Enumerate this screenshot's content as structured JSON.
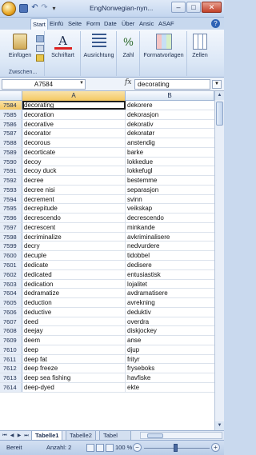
{
  "window": {
    "title": "EngNorwegian-nyn...",
    "minimize": "‒",
    "maximize": "□",
    "close": "✕"
  },
  "ribbon_tabs": [
    "Start",
    "Einfü",
    "Seite",
    "Form",
    "Date",
    "Über",
    "Ansic",
    "ASAF"
  ],
  "ribbon": {
    "paste_label": "Einfügen",
    "clipboard_group": "Zwischen...",
    "font_label": "Schriftart",
    "alignment_label": "Ausrichtung",
    "number_label": "Zahl",
    "styles_label": "Formatvorlagen",
    "cells_label": "Zellen"
  },
  "name_box": "A7584",
  "fx": "fx",
  "formula": "decorating",
  "columns": [
    "A",
    "B"
  ],
  "rows": [
    {
      "n": "7584",
      "a": "decorating",
      "b": "dekorere"
    },
    {
      "n": "7585",
      "a": "decoration",
      "b": "dekorasjon"
    },
    {
      "n": "7586",
      "a": "decorative",
      "b": "dekorativ"
    },
    {
      "n": "7587",
      "a": "decorator",
      "b": "dekoratør"
    },
    {
      "n": "7588",
      "a": "decorous",
      "b": "anstendig"
    },
    {
      "n": "7589",
      "a": "decorticate",
      "b": "barke"
    },
    {
      "n": "7590",
      "a": "decoy",
      "b": "lokkedue"
    },
    {
      "n": "7591",
      "a": "decoy duck",
      "b": "lokkefugl"
    },
    {
      "n": "7592",
      "a": "decree",
      "b": "bestemme"
    },
    {
      "n": "7593",
      "a": "decree nisi",
      "b": "separasjon"
    },
    {
      "n": "7594",
      "a": "decrement",
      "b": "svinn"
    },
    {
      "n": "7595",
      "a": "decrepitude",
      "b": "veikskap"
    },
    {
      "n": "7596",
      "a": "decrescendo",
      "b": "decrescendo"
    },
    {
      "n": "7597",
      "a": "decrescent",
      "b": "minkande"
    },
    {
      "n": "7598",
      "a": "decriminalize",
      "b": "avkriminalisere"
    },
    {
      "n": "7599",
      "a": "decry",
      "b": "nedvurdere"
    },
    {
      "n": "7600",
      "a": "decuple",
      "b": "tidobbel"
    },
    {
      "n": "7601",
      "a": "dedicate",
      "b": "dedisere"
    },
    {
      "n": "7602",
      "a": "dedicated",
      "b": "entusiastisk"
    },
    {
      "n": "7603",
      "a": "dedication",
      "b": "lojalitet"
    },
    {
      "n": "7604",
      "a": "dedramatize",
      "b": "avdramatisere"
    },
    {
      "n": "7605",
      "a": "deduction",
      "b": "avrekning"
    },
    {
      "n": "7606",
      "a": "deductive",
      "b": "deduktiv"
    },
    {
      "n": "7607",
      "a": "deed",
      "b": "overdra"
    },
    {
      "n": "7608",
      "a": "deejay",
      "b": "diskjockey"
    },
    {
      "n": "7609",
      "a": "deem",
      "b": "anse"
    },
    {
      "n": "7610",
      "a": "deep",
      "b": "djup"
    },
    {
      "n": "7611",
      "a": "deep fat",
      "b": "frityr"
    },
    {
      "n": "7612",
      "a": "deep freeze",
      "b": "fryseboks"
    },
    {
      "n": "7613",
      "a": "deep sea fishing",
      "b": "havfiske"
    },
    {
      "n": "7614",
      "a": "deep-dyed",
      "b": "ekte"
    }
  ],
  "sheets": [
    "Tabelle1",
    "Tabelle2",
    "Tabel"
  ],
  "status": {
    "ready": "Bereit",
    "count": "Anzahl: 2",
    "zoom": "100 %"
  },
  "colors": {
    "selection": "#f4c862",
    "ribbon_bg": "#dbe7f6",
    "window_frame": "#c9d9ee"
  }
}
